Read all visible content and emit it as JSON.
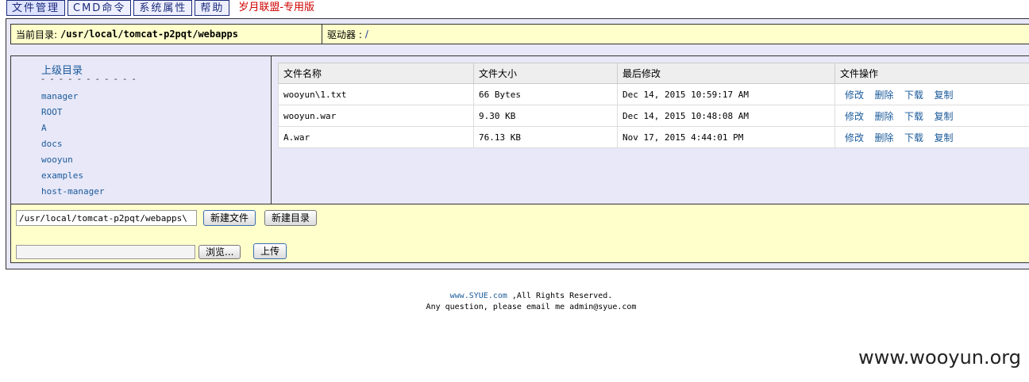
{
  "nav": {
    "items": [
      "文件管理",
      "CMD命令",
      "系统属性",
      "帮助"
    ],
    "brand": "岁月联盟-专用版"
  },
  "path_bar": {
    "current_label": "当前目录:",
    "current_value": "/usr/local/tomcat-p2pqt/webapps",
    "drive_label": "驱动器 :",
    "drive_value": "/"
  },
  "dir_pane": {
    "parent_label": "上级目录",
    "dashes": "- - - - - - - - - - -",
    "dirs": [
      "manager",
      "ROOT",
      "A",
      "docs",
      "wooyun",
      "examples",
      "host-manager"
    ]
  },
  "files": {
    "headers": [
      "文件名称",
      "文件大小",
      "最后修改",
      "文件操作"
    ],
    "rows": [
      {
        "name": "wooyun\\1.txt",
        "size": "66 Bytes",
        "modified": "Dec 14, 2015 10:59:17 AM"
      },
      {
        "name": "wooyun.war",
        "size": "9.30 KB",
        "modified": "Dec 14, 2015 10:48:08 AM"
      },
      {
        "name": "A.war",
        "size": "76.13 KB",
        "modified": "Nov 17, 2015 4:44:01 PM"
      }
    ],
    "ops": [
      "修改",
      "删除",
      "下载",
      "复制"
    ]
  },
  "actions": {
    "path_value": "/usr/local/tomcat-p2pqt/webapps\\",
    "new_file": "新建文件",
    "new_dir": "新建目录",
    "browse": "浏览...",
    "upload": "上传"
  },
  "footer": {
    "link": "www.SYUE.com",
    "rights": " ,All Rights Reserved.",
    "contact": "Any question, please email me admin@syue.com"
  },
  "watermark": "www.wooyun.org"
}
